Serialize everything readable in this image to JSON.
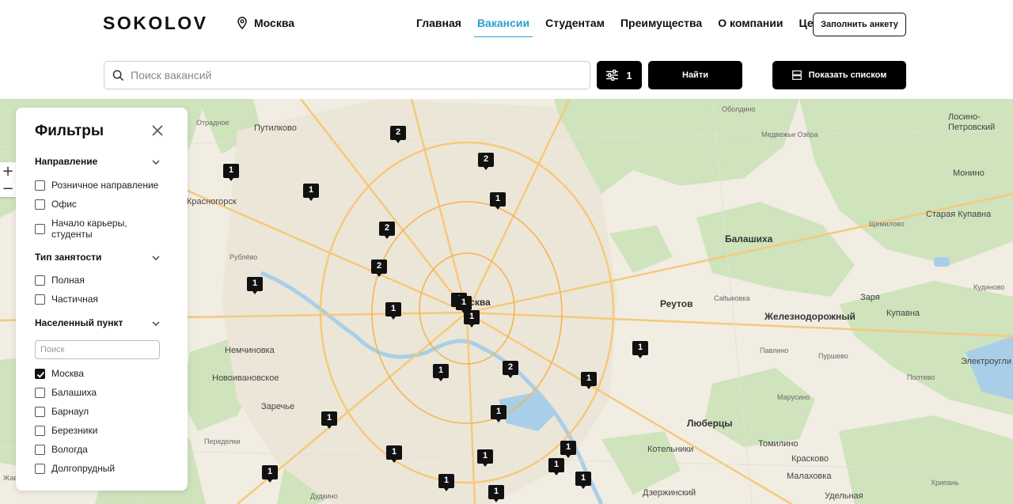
{
  "header": {
    "logo": "SOKOLOV",
    "city": "Москва",
    "nav": [
      {
        "label": "Главная",
        "active": false
      },
      {
        "label": "Вакансии",
        "active": true
      },
      {
        "label": "Студентам",
        "active": false
      },
      {
        "label": "Преимущества",
        "active": false
      },
      {
        "label": "О компании",
        "active": false
      },
      {
        "label": "Ценности",
        "active": false
      }
    ],
    "apply_label": "Заполнить анкету"
  },
  "search": {
    "placeholder": "Поиск вакансий",
    "filter_count": "1",
    "find_label": "Найти",
    "list_label": "Показать списком"
  },
  "filters": {
    "title": "Фильтры",
    "sections": {
      "direction": {
        "title": "Направление",
        "options": [
          {
            "label": "Розничное направление",
            "checked": false
          },
          {
            "label": "Офис",
            "checked": false
          },
          {
            "label": "Начало карьеры, студенты",
            "checked": false
          }
        ]
      },
      "employment": {
        "title": "Тип занятости",
        "options": [
          {
            "label": "Полная",
            "checked": false
          },
          {
            "label": "Частичная",
            "checked": false
          }
        ]
      },
      "locality": {
        "title": "Населенный пункт",
        "search_placeholder": "Поиск",
        "options": [
          {
            "label": "Москва",
            "checked": true
          },
          {
            "label": "Балашиха",
            "checked": false
          },
          {
            "label": "Барнаул",
            "checked": false
          },
          {
            "label": "Березники",
            "checked": false
          },
          {
            "label": "Вологда",
            "checked": false
          },
          {
            "label": "Долгопрудный",
            "checked": false
          }
        ]
      }
    }
  },
  "map": {
    "labels": [
      {
        "text": "Путилково",
        "kind": "normal"
      },
      {
        "text": "Отрадное",
        "kind": "small"
      },
      {
        "text": "Красногорск",
        "kind": "normal"
      },
      {
        "text": "Рублёво",
        "kind": "small"
      },
      {
        "text": "Немчиновка",
        "kind": "normal"
      },
      {
        "text": "Новоивановское",
        "kind": "normal"
      },
      {
        "text": "Заречье",
        "kind": "normal"
      },
      {
        "text": "Переделки",
        "kind": "small"
      },
      {
        "text": "Москва",
        "kind": "big"
      },
      {
        "text": "Реутов",
        "kind": "big"
      },
      {
        "text": "Балашиха",
        "kind": "big"
      },
      {
        "text": "Железнодорожный",
        "kind": "big"
      },
      {
        "text": "Люберцы",
        "kind": "big"
      },
      {
        "text": "Котельники",
        "kind": "normal"
      },
      {
        "text": "Томилино",
        "kind": "normal"
      },
      {
        "text": "Красково",
        "kind": "normal"
      },
      {
        "text": "Малаховка",
        "kind": "normal"
      },
      {
        "text": "Дзержинский",
        "kind": "normal"
      },
      {
        "text": "Удельная",
        "kind": "normal"
      },
      {
        "text": "Дудкино",
        "kind": "small"
      },
      {
        "text": "Саltыковка",
        "kind": "small"
      },
      {
        "text": "Заря",
        "kind": "normal"
      },
      {
        "text": "Купавна",
        "kind": "normal"
      },
      {
        "text": "Старая Купавна",
        "kind": "normal"
      },
      {
        "text": "Монино",
        "kind": "normal"
      },
      {
        "text": "Лосино-Петровский",
        "kind": "normal"
      },
      {
        "text": "Электроугли",
        "kind": "normal"
      },
      {
        "text": "Оболдино",
        "kind": "small"
      },
      {
        "text": "Медвежьи Озёра",
        "kind": "small"
      },
      {
        "text": "Щемилово",
        "kind": "small"
      },
      {
        "text": "Кудиново",
        "kind": "small"
      },
      {
        "text": "Павлино",
        "kind": "small"
      },
      {
        "text": "Пуршево",
        "kind": "small"
      },
      {
        "text": "Полтево",
        "kind": "small"
      },
      {
        "text": "Марусино",
        "kind": "small"
      },
      {
        "text": "Хрипань",
        "kind": "small"
      },
      {
        "text": "Жаво",
        "kind": "small"
      }
    ],
    "markers": [
      "2",
      "2",
      "1",
      "1",
      "1",
      "2",
      "2",
      "1",
      "1",
      "1",
      "1",
      "1",
      "1",
      "2",
      "1",
      "1",
      "1",
      "1",
      "1",
      "1",
      "1",
      "1",
      "1",
      "1",
      "1",
      "1",
      "1"
    ]
  }
}
